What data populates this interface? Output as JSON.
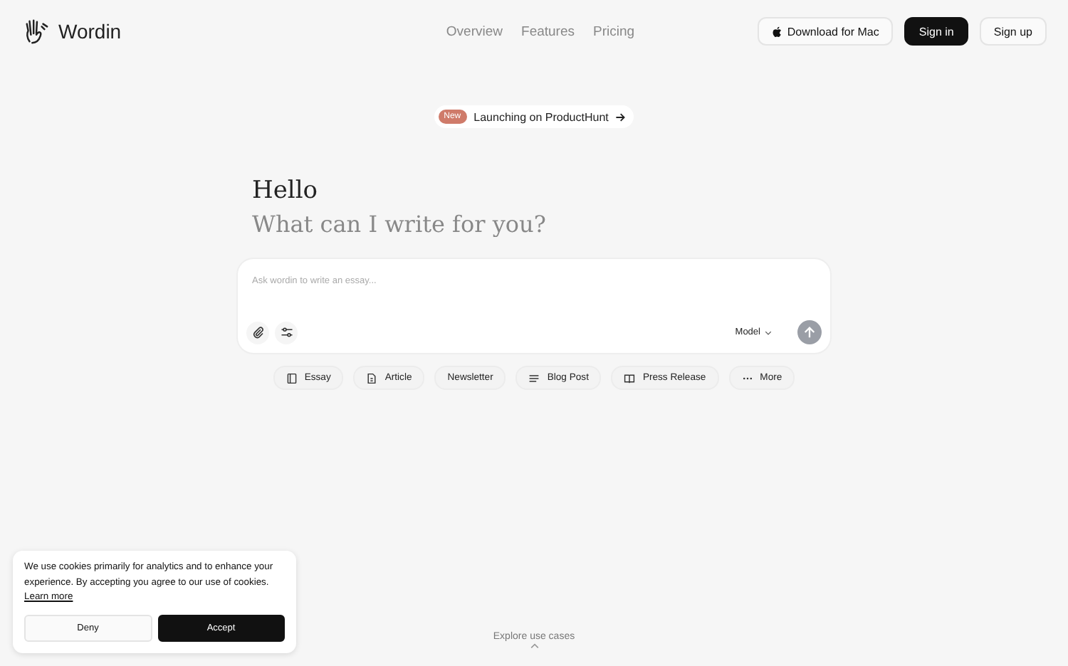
{
  "header": {
    "brand": "Wordin",
    "nav": [
      {
        "label": "Overview"
      },
      {
        "label": "Features"
      },
      {
        "label": "Pricing"
      }
    ],
    "actions": [
      {
        "label": "Download for Mac",
        "kind": "download"
      },
      {
        "label": "Sign in",
        "kind": "primary"
      },
      {
        "label": "Sign up",
        "kind": "outline"
      }
    ]
  },
  "announcement": {
    "badge": "New",
    "text": "Launching on ProductHunt"
  },
  "hero": {
    "greeting": "Hello",
    "question": "What can I write for you?"
  },
  "composer": {
    "placeholder": "Ask wordin to write an essay...",
    "model": "Model"
  },
  "chips": [
    {
      "label": "Essay",
      "kind": "book"
    },
    {
      "label": "Article",
      "kind": "document"
    },
    {
      "label": "Newsletter",
      "kind": "plain"
    },
    {
      "label": "Blog Post",
      "kind": "lines"
    },
    {
      "label": "Press Release",
      "kind": "open-book"
    },
    {
      "label": "More",
      "kind": "dots"
    }
  ],
  "explore": "Explore use cases",
  "cookie": {
    "text": "We use cookies primarily for analytics and to enhance your experience. By accepting you agree to our use of cookies.",
    "link": "Learn more",
    "buttons": [
      {
        "label": "Deny",
        "kind": "outline"
      },
      {
        "label": "Accept",
        "kind": "primary"
      }
    ]
  }
}
